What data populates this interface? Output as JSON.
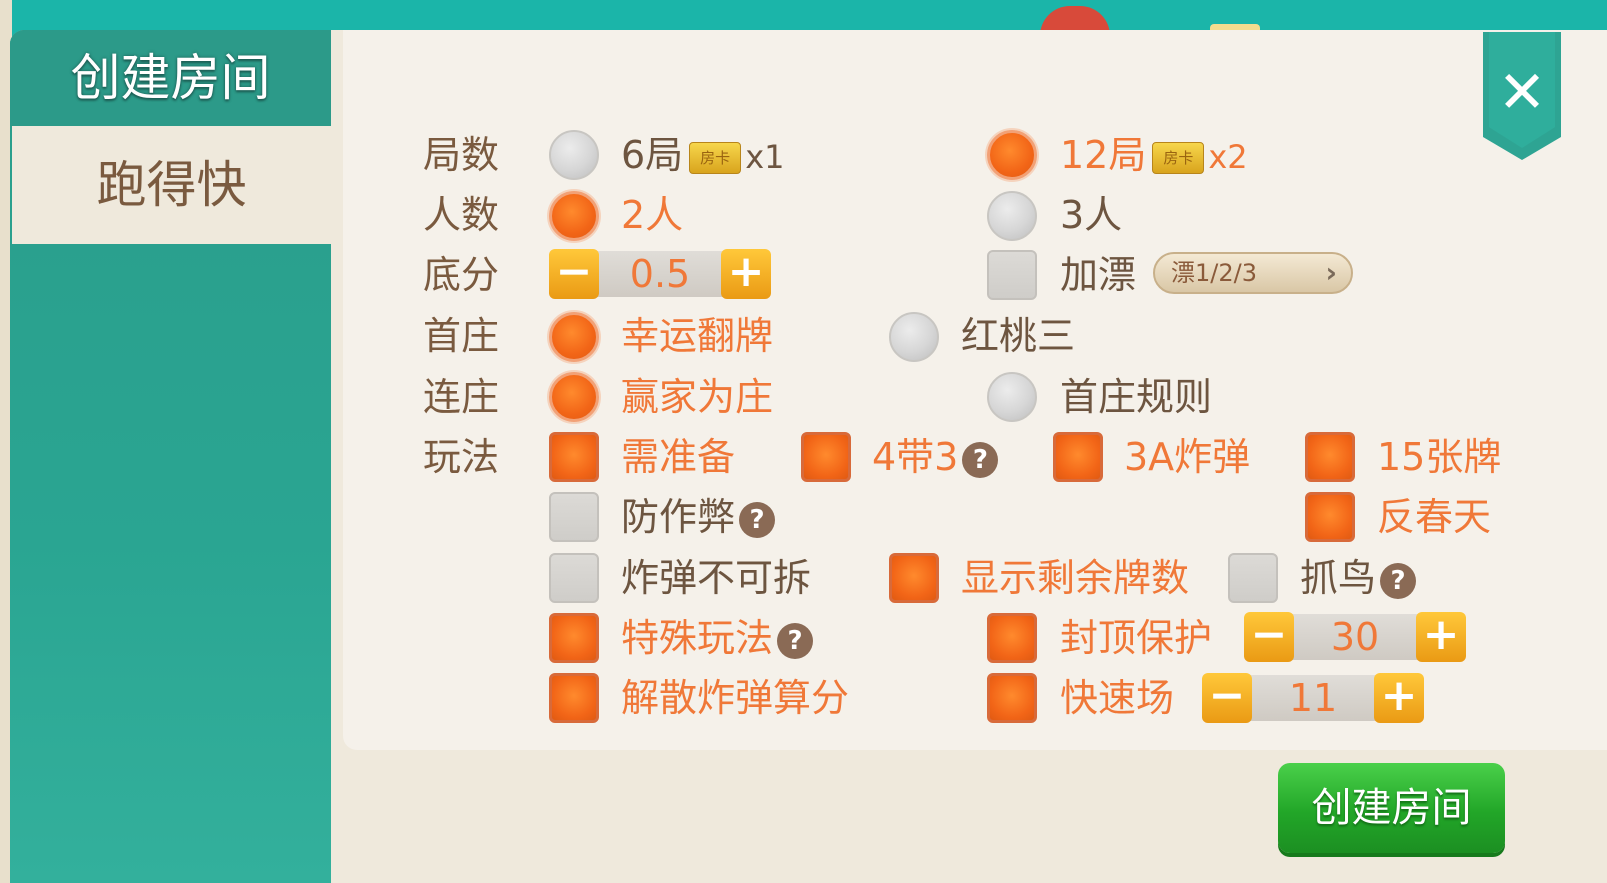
{
  "dialog": {
    "title": "创建房间",
    "close_label": "✕",
    "create_button": "创建房间"
  },
  "sidebar": {
    "tabs": [
      {
        "label": "跑得快",
        "selected": true
      }
    ]
  },
  "options": {
    "rounds": {
      "label": "局数",
      "choices": [
        {
          "label": "6局",
          "card_icon": "房卡",
          "cost": "x1",
          "selected": false
        },
        {
          "label": "12局",
          "card_icon": "房卡",
          "cost": "x2",
          "selected": true
        }
      ]
    },
    "players": {
      "label": "人数",
      "choices": [
        {
          "label": "2人",
          "selected": true
        },
        {
          "label": "3人",
          "selected": false
        }
      ]
    },
    "base_score": {
      "label": "底分",
      "value": "0.5",
      "minus": "−",
      "plus": "+"
    },
    "piao": {
      "label": "加漂",
      "checked": false,
      "select_value": "漂1/2/3",
      "select_chevron": "›"
    },
    "first_banker": {
      "label": "首庄",
      "choices": [
        {
          "label": "幸运翻牌",
          "selected": true
        },
        {
          "label": "红桃三",
          "selected": false
        }
      ]
    },
    "continuous_banker": {
      "label": "连庄",
      "choices": [
        {
          "label": "赢家为庄",
          "selected": true
        },
        {
          "label": "首庄规则",
          "selected": false
        }
      ]
    },
    "gameplay": {
      "label": "玩法",
      "need_ready": {
        "label": "需准备",
        "checked": true
      },
      "four_with_three": {
        "label": "4带3",
        "checked": true,
        "help": "?"
      },
      "triple_a_bomb": {
        "label": "3A炸弹",
        "checked": true
      },
      "fifteen_cards": {
        "label": "15张牌",
        "checked": true
      },
      "anti_cheat": {
        "label": "防作弊",
        "checked": false,
        "help": "?"
      },
      "reverse_spring": {
        "label": "反春天",
        "checked": true
      },
      "bomb_unsplittable": {
        "label": "炸弹不可拆",
        "checked": false
      },
      "show_remaining": {
        "label": "显示剩余牌数",
        "checked": true
      },
      "catch_bird": {
        "label": "抓鸟",
        "checked": false,
        "help": "?"
      },
      "special_play": {
        "label": "特殊玩法",
        "checked": true,
        "help": "?"
      },
      "cap_protection": {
        "label": "封顶保护",
        "checked": true,
        "value": "30",
        "minus": "−",
        "plus": "+"
      },
      "dissolve_bomb_score": {
        "label": "解散炸弹算分",
        "checked": true
      },
      "fast_mode": {
        "label": "快速场",
        "checked": true,
        "value": "11",
        "minus": "−",
        "plus": "+"
      }
    }
  }
}
